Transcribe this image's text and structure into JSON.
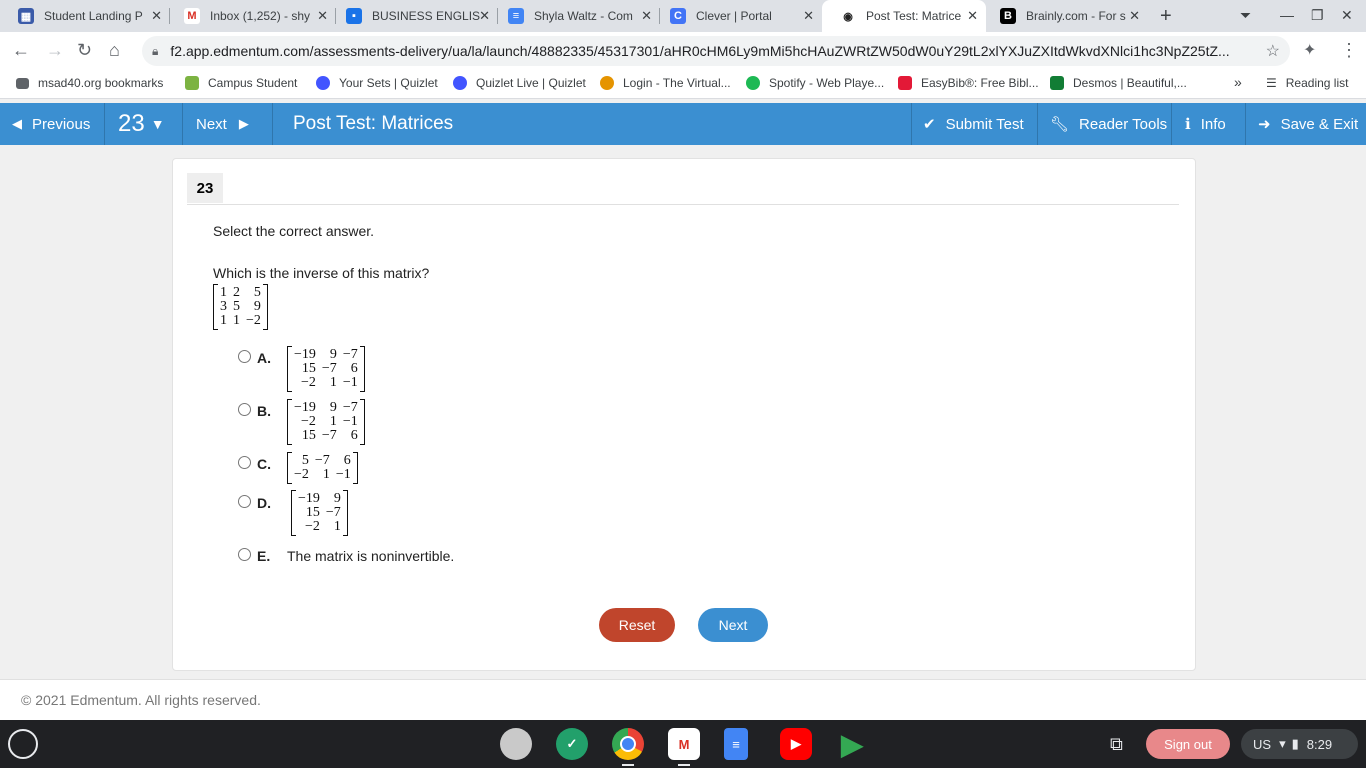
{
  "browser": {
    "tabs": [
      {
        "title": "Student Landing P",
        "icon": "edmentum-icon",
        "color": "#3b5ba9"
      },
      {
        "title": "Inbox (1,252) - shy",
        "icon": "gmail-icon",
        "color": "#d93025"
      },
      {
        "title": "BUSINESS ENGLIS",
        "icon": "classroom-icon",
        "color": "#1a73e8"
      },
      {
        "title": "Shyla Waltz - Com",
        "icon": "docs-icon",
        "color": "#4285f4"
      },
      {
        "title": "Clever | Portal",
        "icon": "clever-icon",
        "color": "#4274f6"
      },
      {
        "title": "Post Test: Matrice",
        "icon": "edmentum-icon",
        "color": "#222222"
      },
      {
        "title": "Brainly.com - For s",
        "icon": "brainly-icon",
        "color": "#000000"
      }
    ],
    "url": "f2.app.edmentum.com/assessments-delivery/ua/la/launch/48882335/45317301/aHR0cHM6Ly9mMi5hcHAuZWRtZW50dW0uY29tL2xlYXJuZXItdWkvdXNlci1hc3NpZ25tZ...",
    "bookmarks": [
      {
        "label": "msad40.org bookmarks",
        "color": "#5f6368"
      },
      {
        "label": "Campus Student",
        "color": "#7cb342"
      },
      {
        "label": "Your Sets | Quizlet",
        "color": "#4255ff"
      },
      {
        "label": "Quizlet Live | Quizlet",
        "color": "#4255ff"
      },
      {
        "label": "Login - The Virtual...",
        "color": "#e59400"
      },
      {
        "label": "Spotify - Web Playe...",
        "color": "#1db954"
      },
      {
        "label": "EasyBib®: Free Bibl...",
        "color": "#e31937"
      },
      {
        "label": "Desmos | Beautiful,...",
        "color": "#127d35"
      }
    ],
    "more": "»",
    "reading_list": "Reading list"
  },
  "toolbar": {
    "previous": "Previous",
    "question_number": "23",
    "next": "Next",
    "title": "Post Test: Matrices",
    "submit": "Submit Test",
    "reader_tools": "Reader Tools",
    "info": "Info",
    "save_exit": "Save & Exit"
  },
  "question": {
    "number": "23",
    "instruction": "Select the correct answer.",
    "prompt": "Which is the inverse of this matrix?",
    "matrix": [
      [
        "1",
        "2",
        "5"
      ],
      [
        "3",
        "5",
        "9"
      ],
      [
        "1",
        "1",
        "−2"
      ]
    ],
    "options": [
      {
        "letter": "A.",
        "matrix": [
          [
            "−19",
            "9",
            "−7"
          ],
          [
            "15",
            "−7",
            "6"
          ],
          [
            "−2",
            "1",
            "−1"
          ]
        ]
      },
      {
        "letter": "B.",
        "matrix": [
          [
            "−19",
            "9",
            "−7"
          ],
          [
            "−2",
            "1",
            "−1"
          ],
          [
            "15",
            "−7",
            "6"
          ]
        ]
      },
      {
        "letter": "C.",
        "matrix": [
          [
            "5",
            "−7",
            "6"
          ],
          [
            "−2",
            "1",
            "−1"
          ]
        ]
      },
      {
        "letter": "D.",
        "matrix": [
          [
            "−19",
            "9"
          ],
          [
            "15",
            "−7"
          ],
          [
            "−2",
            "1"
          ]
        ]
      },
      {
        "letter": "E.",
        "text": "The matrix is noninvertible."
      }
    ]
  },
  "buttons": {
    "reset": "Reset",
    "next": "Next"
  },
  "footer": {
    "copyright": "© 2021 Edmentum. All rights reserved."
  },
  "shelf": {
    "sign_out": "Sign out",
    "locale": "US",
    "time": "8:29"
  }
}
